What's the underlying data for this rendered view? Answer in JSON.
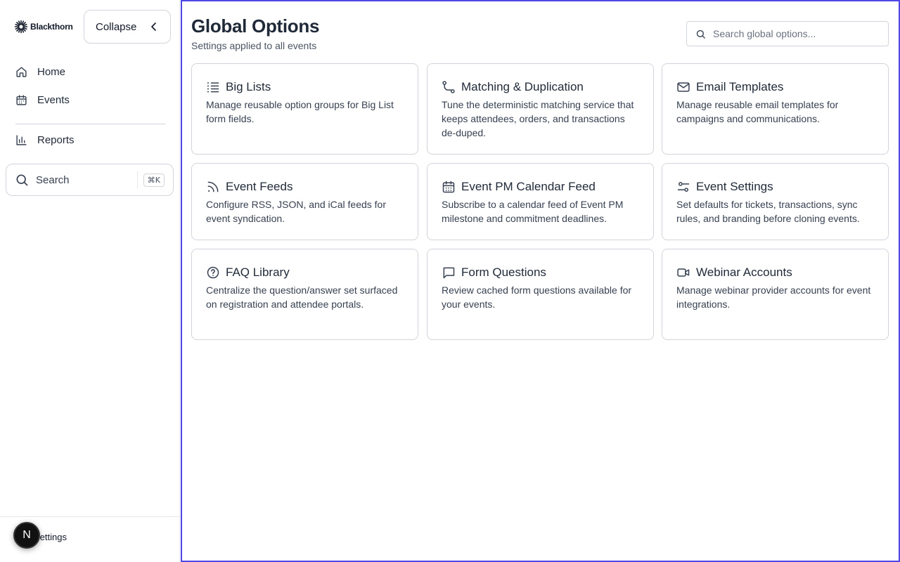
{
  "sidebar": {
    "brand": "Blackthorn",
    "collapse_label": "Collapse",
    "nav": [
      {
        "label": "Home",
        "icon": "home-icon"
      },
      {
        "label": "Events",
        "icon": "calendar-icon"
      },
      {
        "label": "Reports",
        "icon": "bar-chart-icon"
      }
    ],
    "search": {
      "placeholder": "Search",
      "shortcut": "⌘K"
    },
    "settings_label": "Settings",
    "avatar_letter": "N"
  },
  "page": {
    "title": "Global Options",
    "subtitle": "Settings applied to all events",
    "search_placeholder": "Search global options..."
  },
  "cards": [
    {
      "title": "Big Lists",
      "description": "Manage reusable option groups for Big List form fields.",
      "icon": "list-icon"
    },
    {
      "title": "Matching & Duplication",
      "description": "Tune the deterministic matching service that keeps attendees, orders, and transactions de-duped.",
      "icon": "route-icon"
    },
    {
      "title": "Email Templates",
      "description": "Manage reusable email templates for campaigns and communications.",
      "icon": "mail-icon"
    },
    {
      "title": "Event Feeds",
      "description": "Configure RSS, JSON, and iCal feeds for event syndication.",
      "icon": "rss-icon"
    },
    {
      "title": "Event PM Calendar Feed",
      "description": "Subscribe to a calendar feed of Event PM milestone and commitment deadlines.",
      "icon": "calendar-grid-icon"
    },
    {
      "title": "Event Settings",
      "description": "Set defaults for tickets, transactions, sync rules, and branding before cloning events.",
      "icon": "sliders-icon"
    },
    {
      "title": "FAQ Library",
      "description": "Centralize the question/answer set surfaced on registration and attendee portals.",
      "icon": "help-circle-icon"
    },
    {
      "title": "Form Questions",
      "description": "Review cached form questions available for your events.",
      "icon": "message-square-icon"
    },
    {
      "title": "Webinar Accounts",
      "description": "Manage webinar provider accounts for event integrations.",
      "icon": "video-icon"
    }
  ],
  "colors": {
    "accent_border": "#4f46e5",
    "border": "#d1d5db",
    "text": "#1f2937"
  }
}
